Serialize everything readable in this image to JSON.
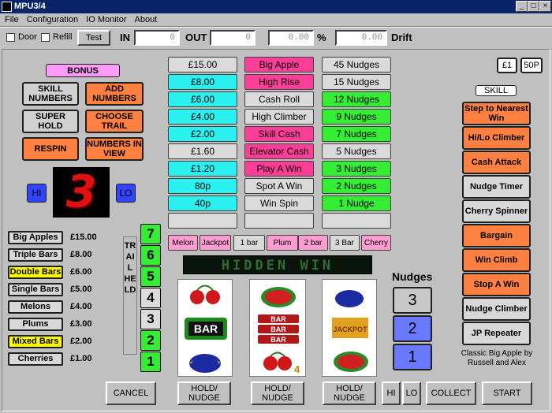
{
  "window": {
    "title": "MPU3/4",
    "min": "_",
    "max": "□",
    "close": "×"
  },
  "menu": [
    "File",
    "Configuration",
    "IO Monitor",
    "About"
  ],
  "toolbar": {
    "door": "Door",
    "refill": "Refill",
    "test": "Test",
    "in_label": "IN",
    "in_value": "0",
    "out_label": "OUT",
    "out_value": "0",
    "percent_value": "0.00",
    "percent_sign": "%",
    "drift_value": "0.00",
    "drift_label": "Drift"
  },
  "left": {
    "bonus": "BONUS",
    "skill_numbers": "SKILL NUMBERS",
    "add_numbers": "ADD NUMBERS",
    "super_hold": "SUPER HOLD",
    "choose_trail": "CHOOSE TRAIL",
    "respin": "RESPIN",
    "numbers_in_view": "NUMBERS IN VIEW",
    "hi": "HI",
    "lo": "LO",
    "number": "3"
  },
  "paytable": [
    {
      "name": "Big Apples",
      "value": "£15.00",
      "highlight": false
    },
    {
      "name": "Triple Bars",
      "value": "£8.00",
      "highlight": false
    },
    {
      "name": "Double Bars",
      "value": "£6.00",
      "highlight": true
    },
    {
      "name": "Single Bars",
      "value": "£5.00",
      "highlight": false
    },
    {
      "name": "Melons",
      "value": "£4.00",
      "highlight": false
    },
    {
      "name": "Plums",
      "value": "£3.00",
      "highlight": false
    },
    {
      "name": "Mixed Bars",
      "value": "£2.00",
      "highlight": true
    },
    {
      "name": "Cherries",
      "value": "£1.00",
      "highlight": false
    }
  ],
  "trail": {
    "vertical_text": "TRAIL HELD",
    "steps": [
      "7",
      "6",
      "5",
      "4",
      "3",
      "2",
      "1"
    ]
  },
  "col1": [
    "£15.00",
    "£8.00",
    "£6.00",
    "£4.00",
    "£2.00",
    "£1.60",
    "£1.20",
    "80p",
    "40p",
    ""
  ],
  "col2": [
    "Big Apple",
    "High Rise",
    "Cash Roll",
    "High Climber",
    "Skill Cash",
    "Elevator Cash",
    "Play A Win",
    "Spot A Win",
    "Win Spin",
    ""
  ],
  "col3": [
    "45 Nudges",
    "15 Nudges",
    "12 Nudges",
    "9 Nudges",
    "7 Nudges",
    "5 Nudges",
    "3 Nudges",
    "2 Nudges",
    "1 Nudge",
    ""
  ],
  "symbols": [
    "Melon",
    "Jackpot",
    "1 bar",
    "Plum",
    "2 bar",
    "3 Bar",
    "Cherry"
  ],
  "dot_display": "HIDDEN WIN",
  "reels": [
    [
      "cherry",
      "bar",
      "plum"
    ],
    [
      "melon",
      "triple bar",
      "cherry"
    ],
    [
      "plum",
      "jackpot",
      "melon"
    ]
  ],
  "nudges": {
    "label": "Nudges",
    "values": [
      "3",
      "2",
      "1"
    ]
  },
  "right": {
    "coin1": "£1",
    "coin2": "50P",
    "skill": "SKILL",
    "features": [
      "Step to Nearest Win",
      "Hi/Lo Climber",
      "Cash Attack",
      "Nudge Timer",
      "Cherry Spinner",
      "Bargain",
      "Win Climb",
      "Stop A Win",
      "Nudge Climber",
      "JP Repeater"
    ],
    "credit": "Classic Big Apple by Russell and Alex"
  },
  "bottom": {
    "cancel": "CANCEL",
    "hold": "HOLD/ NUDGE",
    "hi": "HI",
    "lo": "LO",
    "collect": "COLLECT",
    "start": "START"
  },
  "colors": {
    "green": "#33ee33",
    "cyan": "#2af0f0",
    "pink": "#ff3e98",
    "orange": "#ff8040",
    "blue": "#3344ff",
    "yellow": "#ffff00"
  }
}
